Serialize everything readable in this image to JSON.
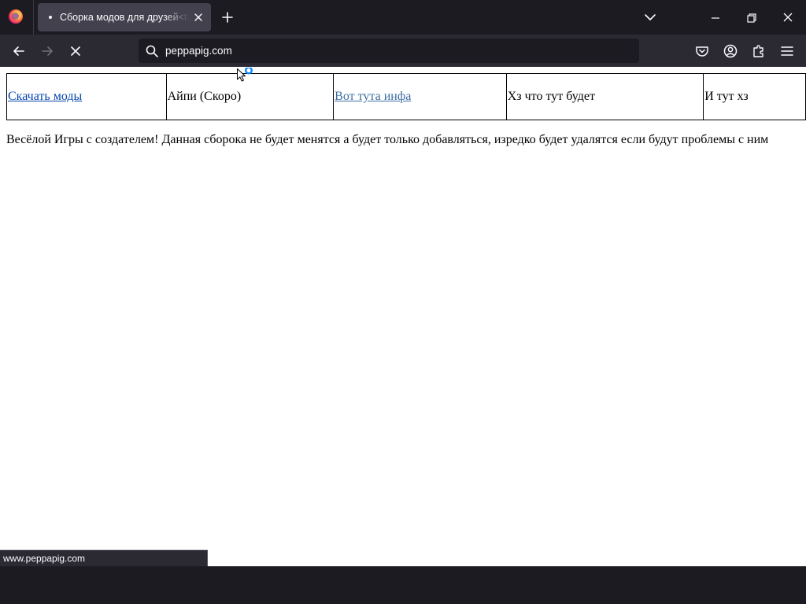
{
  "browser": {
    "tab": {
      "title": "Сборка модов для друзей<titl"
    },
    "address_bar": {
      "url": "peppapig.com"
    },
    "status_url": "www.peppapig.com"
  },
  "page": {
    "nav_cells": [
      {
        "text": "Скачать моды",
        "is_link": true
      },
      {
        "text": "Айпи (Скоро)",
        "is_link": false
      },
      {
        "text": "Вот тута инфа",
        "is_link": true
      },
      {
        "text": "Хз что тут будет",
        "is_link": false
      },
      {
        "text": "И тут хз",
        "is_link": false
      }
    ],
    "intro_text": "Весёлой Игры с создателем! Данная сборока не будет менятся а будет только добавляться, изредко будет удалятся если будут проблемы с ним"
  },
  "icons": {
    "browser_logo": "firefox-logo-icon",
    "tab_favicon": "loading-dot-icon",
    "tab_close": "close-icon",
    "new_tab": "plus-icon",
    "list_tabs": "chevron-down-icon",
    "window_minimize": "minimize-icon",
    "window_restore": "restore-icon",
    "window_close": "close-icon",
    "back": "arrow-left-icon",
    "forward": "arrow-right-icon",
    "stop": "stop-icon",
    "search": "search-icon",
    "pocket": "pocket-icon",
    "account": "account-icon",
    "extensions": "puzzle-icon",
    "menu": "hamburger-menu-icon",
    "cursor": "busy-cursor-icon"
  },
  "colors": {
    "chrome_dark": "#1c1b22",
    "toolbar": "#2b2a33",
    "active_tab": "#42414d",
    "link": "#0645ad",
    "busy_indicator": "#0a84ff"
  }
}
